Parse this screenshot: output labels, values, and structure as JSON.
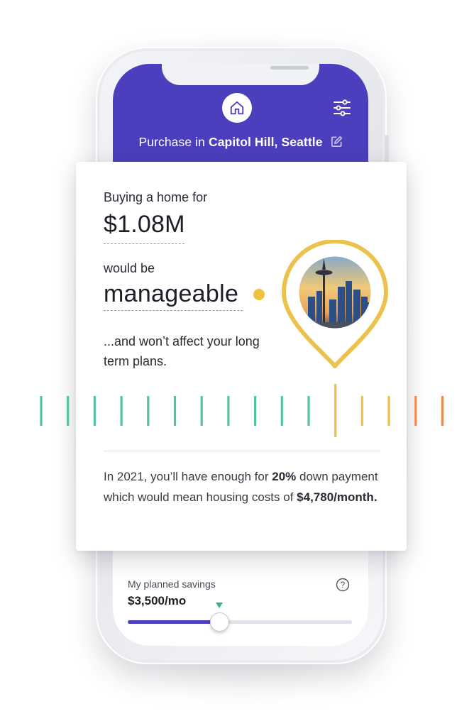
{
  "header": {
    "title_prefix": "Purchase in",
    "location": "Capitol Hill, Seattle",
    "home_icon": "home-icon",
    "filter_icon": "sliders-icon",
    "edit_icon": "edit-icon",
    "color": "#4b3fbd"
  },
  "card": {
    "intro": "Buying a home for",
    "price": "$1.08M",
    "would_be": "would be",
    "rating": "manageable",
    "rating_color": "#f0c040",
    "note": "...and won’t affect your long term plans.",
    "image_icon": "location-pin-icon",
    "scale": {
      "colors": [
        "#52c39b",
        "#52c39b",
        "#52c39b",
        "#52c39b",
        "#52c39b",
        "#52c39b",
        "#52c39b",
        "#52c39b",
        "#52c39b",
        "#52c39b",
        "#52c39b",
        "#f0c040",
        "#f0c040",
        "#f0c040",
        "#f08a50",
        "#f08a50"
      ],
      "current_index": 11
    },
    "summary": {
      "prefix": "In 2021, you’ll have enough for",
      "percent": "20%",
      "middle": "down payment which would mean housing costs of",
      "monthly": "$4,780/month."
    }
  },
  "savings": {
    "label": "My planned savings",
    "value": "$3,500/mo",
    "help_icon": "help-icon",
    "slider_level": 0.41
  }
}
